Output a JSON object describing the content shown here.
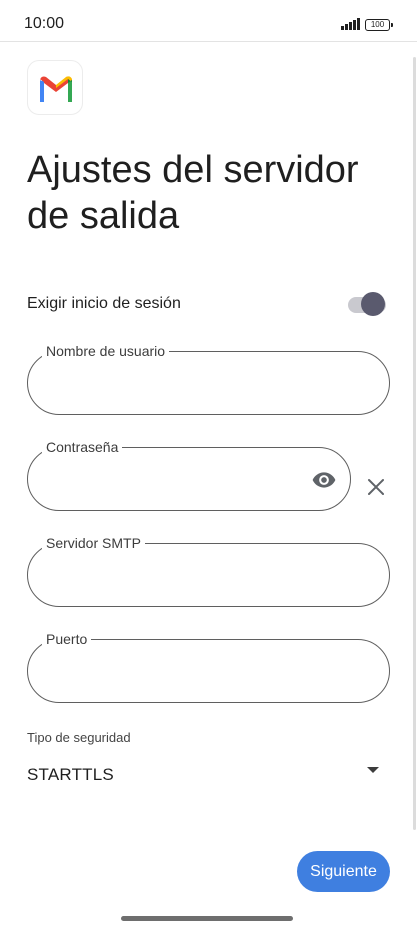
{
  "status_bar": {
    "time": "10:00",
    "battery": "100"
  },
  "app": {
    "logo_icon": "gmail-logo-icon"
  },
  "page": {
    "title": "Ajustes del servidor de salida"
  },
  "require_login": {
    "label": "Exigir inicio de sesión",
    "enabled": true
  },
  "fields": {
    "username": {
      "label": "Nombre de usuario",
      "value": ""
    },
    "password": {
      "label": "Contraseña",
      "value": ""
    },
    "smtp_server": {
      "label": "Servidor SMTP",
      "value": ""
    },
    "port": {
      "label": "Puerto",
      "value": ""
    }
  },
  "security": {
    "label": "Tipo de seguridad",
    "selected": "STARTTLS"
  },
  "actions": {
    "next_label": "Siguiente"
  },
  "colors": {
    "accent": "#3f7fe0",
    "toggle_thumb": "#5a5a6e"
  }
}
